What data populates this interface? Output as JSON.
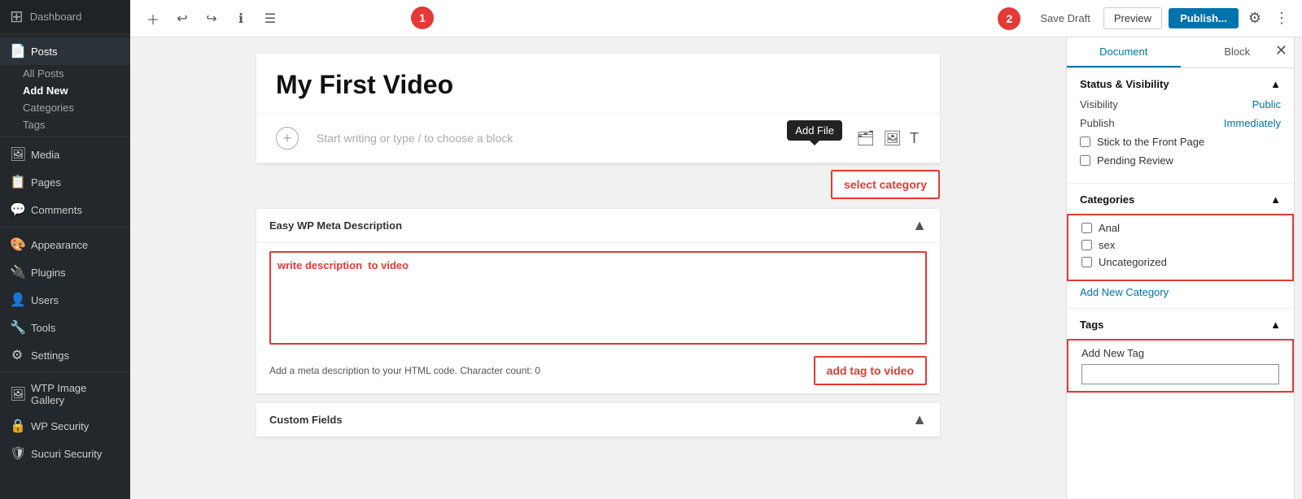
{
  "sidebar": {
    "logo_text": "Dashboard",
    "items": [
      {
        "id": "dashboard",
        "label": "Dashboard",
        "icon": "⊞",
        "active": false
      },
      {
        "id": "posts",
        "label": "Posts",
        "icon": "📄",
        "active": true
      },
      {
        "id": "all-posts",
        "label": "All Posts",
        "sub": true,
        "active": false
      },
      {
        "id": "add-new",
        "label": "Add New",
        "sub": true,
        "active": true
      },
      {
        "id": "categories",
        "label": "Categories",
        "sub": true,
        "active": false
      },
      {
        "id": "tags",
        "label": "Tags",
        "sub": true,
        "active": false
      },
      {
        "id": "media",
        "label": "Media",
        "icon": "🖼",
        "active": false
      },
      {
        "id": "pages",
        "label": "Pages",
        "icon": "📋",
        "active": false
      },
      {
        "id": "comments",
        "label": "Comments",
        "icon": "💬",
        "active": false
      },
      {
        "id": "appearance",
        "label": "Appearance",
        "icon": "🎨",
        "active": false
      },
      {
        "id": "plugins",
        "label": "Plugins",
        "icon": "🔌",
        "active": false
      },
      {
        "id": "users",
        "label": "Users",
        "icon": "👤",
        "active": false
      },
      {
        "id": "tools",
        "label": "Tools",
        "icon": "🔧",
        "active": false
      },
      {
        "id": "settings",
        "label": "Settings",
        "icon": "⚙",
        "active": false
      },
      {
        "id": "wtp-gallery",
        "label": "WTP Image Gallery",
        "icon": "🖼",
        "active": false
      },
      {
        "id": "wp-security",
        "label": "WP Security",
        "icon": "🔒",
        "active": false
      },
      {
        "id": "sucuri",
        "label": "Sucuri Security",
        "icon": "🛡",
        "active": false
      }
    ]
  },
  "toolbar": {
    "add_block_label": "+",
    "undo_label": "↩",
    "redo_label": "↪",
    "info_label": "ℹ",
    "list_view_label": "☰",
    "save_draft_label": "Save Draft",
    "preview_label": "Preview",
    "publish_label": "Publish...",
    "settings_label": "⚙",
    "more_label": "⋮",
    "badge_1": "1",
    "badge_2": "2"
  },
  "editor": {
    "title": "My First Video",
    "placeholder": "Start writing or type / to choose a block",
    "add_file_tooltip": "Add File"
  },
  "meta_description": {
    "section_title": "Easy WP Meta Description",
    "description_text": "write description  to video",
    "footer_text": "Add a meta description to your HTML code. Character count: 0"
  },
  "annotation_boxes": {
    "select_category": "select category",
    "add_tag": "add tag to video"
  },
  "custom_fields": {
    "section_title": "Custom Fields"
  },
  "right_panel": {
    "tab_document": "Document",
    "tab_block": "Block",
    "status_visibility_title": "Status & Visibility",
    "visibility_label": "Visibility",
    "visibility_value": "Public",
    "publish_label": "Publish",
    "publish_value": "Immediately",
    "stick_front_page": "Stick to the Front Page",
    "pending_review": "Pending Review",
    "categories_title": "Categories",
    "categories": [
      {
        "label": "Anal",
        "checked": false
      },
      {
        "label": "sex",
        "checked": false
      },
      {
        "label": "Uncategorized",
        "checked": false
      }
    ],
    "add_new_category": "Add New Category",
    "tags_title": "Tags",
    "add_new_tag_label": "Add New Tag",
    "tag_input_placeholder": ""
  }
}
